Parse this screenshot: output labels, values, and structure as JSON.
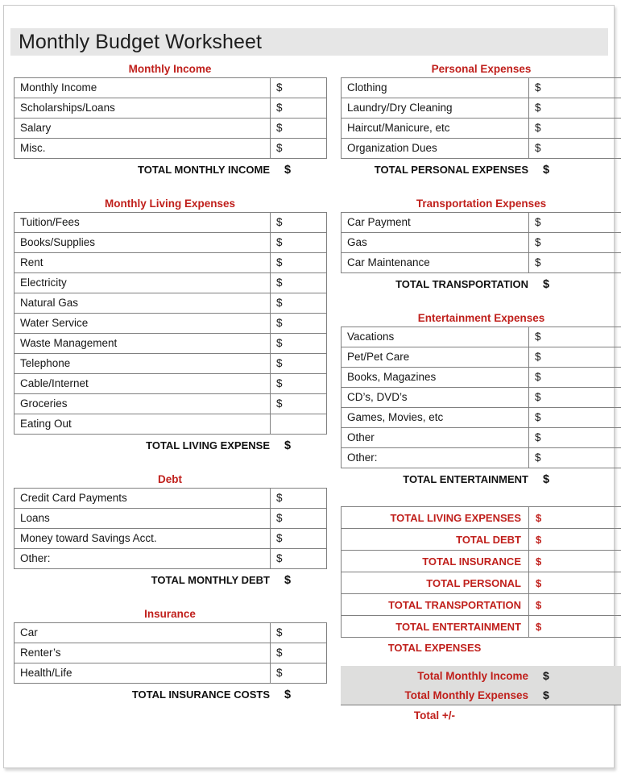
{
  "document": {
    "title": "Monthly Budget Worksheet",
    "currency_symbol": "$",
    "accent_color": "#C0201C",
    "title_band_color": "#E6E6E6",
    "shaded_block_color": "#DEDEDD"
  },
  "sections": {
    "monthly_income": {
      "heading": "Monthly Income",
      "rows": [
        {
          "label": "Monthly Income",
          "amount": "$"
        },
        {
          "label": "Scholarships/Loans",
          "amount": "$"
        },
        {
          "label": "Salary",
          "amount": "$"
        },
        {
          "label": "Misc.",
          "amount": "$"
        }
      ],
      "total_label": "TOTAL MONTHLY INCOME",
      "total_amount": "$"
    },
    "monthly_living_expenses": {
      "heading": "Monthly Living Expenses",
      "rows": [
        {
          "label": "Tuition/Fees",
          "amount": "$"
        },
        {
          "label": "Books/Supplies",
          "amount": "$"
        },
        {
          "label": "Rent",
          "amount": "$"
        },
        {
          "label": "Electricity",
          "amount": "$"
        },
        {
          "label": "Natural Gas",
          "amount": "$"
        },
        {
          "label": "Water Service",
          "amount": "$"
        },
        {
          "label": "Waste Management",
          "amount": "$"
        },
        {
          "label": "Telephone",
          "amount": "$"
        },
        {
          "label": "Cable/Internet",
          "amount": "$"
        },
        {
          "label": "Groceries",
          "amount": "$"
        },
        {
          "label": "Eating Out",
          "amount": ""
        }
      ],
      "total_label": "TOTAL LIVING EXPENSE",
      "total_amount": "$"
    },
    "debt": {
      "heading": "Debt",
      "rows": [
        {
          "label": "Credit Card Payments",
          "amount": "$"
        },
        {
          "label": "Loans",
          "amount": "$"
        },
        {
          "label": "Money toward Savings Acct.",
          "amount": "$"
        },
        {
          "label": "Other:",
          "amount": "$"
        }
      ],
      "total_label": "TOTAL MONTHLY DEBT",
      "total_amount": "$"
    },
    "insurance": {
      "heading": "Insurance",
      "rows": [
        {
          "label": "Car",
          "amount": "$"
        },
        {
          "label": "Renter’s",
          "amount": "$"
        },
        {
          "label": "Health/Life",
          "amount": "$"
        }
      ],
      "total_label": "TOTAL INSURANCE COSTS",
      "total_amount": "$"
    },
    "personal_expenses": {
      "heading": "Personal Expenses",
      "rows": [
        {
          "label": "Clothing",
          "amount": "$"
        },
        {
          "label": "Laundry/Dry Cleaning",
          "amount": "$"
        },
        {
          "label": "Haircut/Manicure, etc",
          "amount": "$"
        },
        {
          "label": "Organization Dues",
          "amount": "$"
        }
      ],
      "total_label": "TOTAL PERSONAL EXPENSES",
      "total_amount": "$"
    },
    "transportation_expenses": {
      "heading": "Transportation Expenses",
      "rows": [
        {
          "label": "Car Payment",
          "amount": "$"
        },
        {
          "label": "Gas",
          "amount": "$"
        },
        {
          "label": "Car Maintenance",
          "amount": "$"
        }
      ],
      "total_label": "TOTAL TRANSPORTATION",
      "total_amount": "$"
    },
    "entertainment_expenses": {
      "heading": "Entertainment Expenses",
      "rows": [
        {
          "label": "Vacations",
          "amount": "$"
        },
        {
          "label": "Pet/Pet Care",
          "amount": "$"
        },
        {
          "label": "Books, Magazines",
          "amount": "$"
        },
        {
          "label": "CD’s, DVD’s",
          "amount": "$"
        },
        {
          "label": "Games, Movies, etc",
          "amount": "$"
        },
        {
          "label": "Other",
          "amount": "$"
        },
        {
          "label": "Other:",
          "amount": "$"
        }
      ],
      "total_label": "TOTAL ENTERTAINMENT",
      "total_amount": "$"
    }
  },
  "summary": {
    "rows": [
      {
        "label": "TOTAL LIVING EXPENSES",
        "amount": "$"
      },
      {
        "label": "TOTAL DEBT",
        "amount": "$"
      },
      {
        "label": "TOTAL INSURANCE",
        "amount": "$"
      },
      {
        "label": "TOTAL PERSONAL",
        "amount": "$"
      },
      {
        "label": "TOTAL TRANSPORTATION",
        "amount": "$"
      },
      {
        "label": "TOTAL ENTERTAINMENT",
        "amount": "$"
      }
    ],
    "footer_label": "TOTAL EXPENSES"
  },
  "final_block": {
    "rows": [
      {
        "label": "Total Monthly Income",
        "amount": "$"
      },
      {
        "label": "Total Monthly Expenses",
        "amount": "$"
      }
    ],
    "net_label": "Total +/-"
  }
}
